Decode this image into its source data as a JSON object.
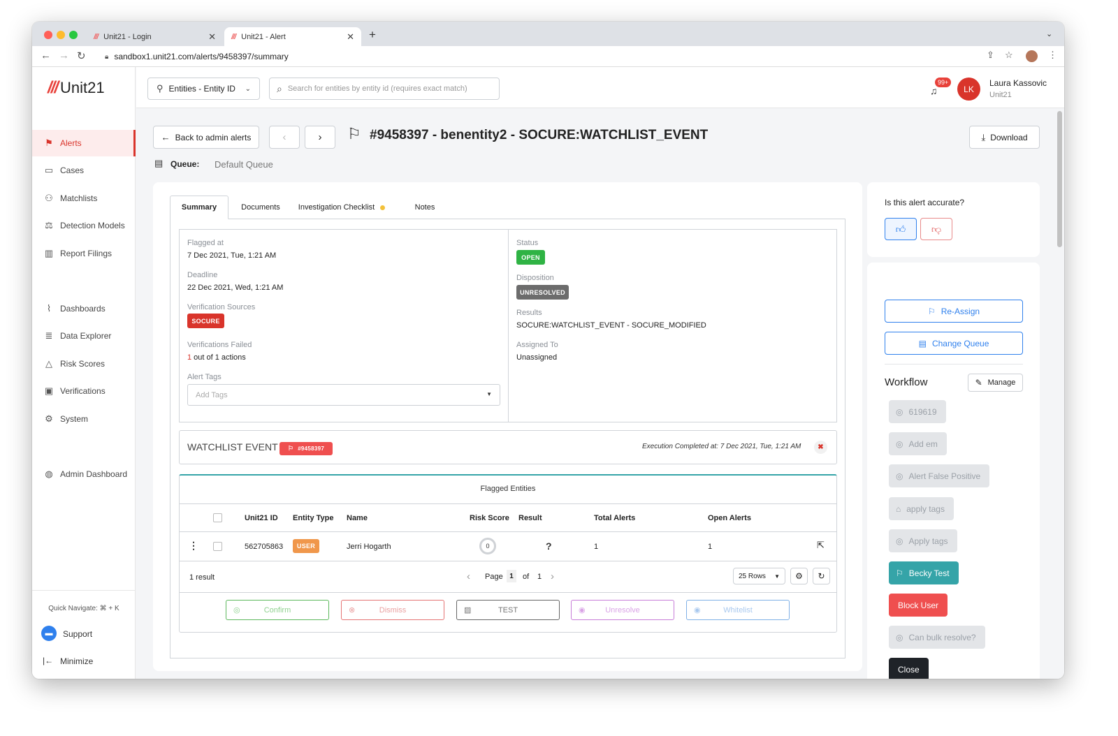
{
  "browser": {
    "tabs": [
      {
        "label": "Unit21 - Login",
        "active": false
      },
      {
        "label": "Unit21 - Alert",
        "active": true
      }
    ],
    "new_tab": "+",
    "url": "sandbox1.unit21.com/alerts/9458397/summary"
  },
  "sidebar": {
    "logo": "Unit21",
    "items": [
      {
        "label": "Alerts",
        "icon": "flag-icon",
        "active": true
      },
      {
        "label": "Cases",
        "icon": "briefcase-icon"
      },
      {
        "label": "Matchlists",
        "icon": "user-list-icon"
      },
      {
        "label": "Detection Models",
        "icon": "scale-icon"
      },
      {
        "label": "Report Filings",
        "icon": "building-icon"
      },
      {
        "label": "Dashboards",
        "icon": "chart-icon"
      },
      {
        "label": "Data Explorer",
        "icon": "explorer-icon"
      },
      {
        "label": "Risk Scores",
        "icon": "warning-icon"
      },
      {
        "label": "Verifications",
        "icon": "id-card-icon"
      },
      {
        "label": "System",
        "icon": "gear-icon"
      },
      {
        "label": "Admin Dashboard",
        "icon": "globe-icon"
      }
    ],
    "quick_navigate": "Quick Navigate: ⌘ + K",
    "support": "Support",
    "minimize": "Minimize"
  },
  "topbar": {
    "entity_select": "Entities - Entity ID",
    "search_placeholder": "Search for entities by entity id (requires exact match)",
    "notif_count": "99+",
    "user_initials": "LK",
    "user_name": "Laura Kassovic",
    "user_org": "Unit21"
  },
  "header": {
    "back_label": "Back to admin alerts",
    "title": "#9458397 - benentity2 - SOCURE:WATCHLIST_EVENT",
    "download_label": "Download",
    "queue_label": "Queue:",
    "queue_value": "Default Queue"
  },
  "tabs": [
    "Summary",
    "Documents",
    "Investigation Checklist",
    "Notes"
  ],
  "summary": {
    "flagged_at_label": "Flagged at",
    "flagged_at": "7 Dec 2021, Tue, 1:21 AM",
    "deadline_label": "Deadline",
    "deadline": "22 Dec 2021, Wed, 1:21 AM",
    "verification_sources_label": "Verification Sources",
    "verification_source": "SOCURE",
    "verifications_failed_label": "Verifications Failed",
    "failed_count": "1",
    "failed_rest": " out of 1 actions",
    "alert_tags_label": "Alert Tags",
    "tags_placeholder": "Add Tags",
    "status_label": "Status",
    "status": "OPEN",
    "disposition_label": "Disposition",
    "disposition": "UNRESOLVED",
    "results_label": "Results",
    "results": "SOCURE:WATCHLIST_EVENT - SOCURE_MODIFIED",
    "assigned_label": "Assigned To",
    "assigned": "Unassigned"
  },
  "event": {
    "title": "WATCHLIST EVENT",
    "badge": "#9458397",
    "execution": "Execution Completed at: 7 Dec 2021, Tue, 1:21 AM"
  },
  "table": {
    "title": "Flagged Entities",
    "columns": [
      "Unit21 ID",
      "Entity Type",
      "Name",
      "Risk Score",
      "Result",
      "Total Alerts",
      "Open Alerts"
    ],
    "rows": [
      {
        "id": "562705863",
        "type": "USER",
        "name": "Jerri Hogarth",
        "risk": "0",
        "result": "?",
        "total": "1",
        "open": "1"
      }
    ],
    "result_count": "1 result",
    "page_label": "Page",
    "page": "1",
    "of_label": "of",
    "pages": "1",
    "rows_select": "25 Rows"
  },
  "actions": [
    {
      "label": "Confirm",
      "color": "#5cb85c"
    },
    {
      "label": "Dismiss",
      "color": "#e57373"
    },
    {
      "label": "TEST",
      "color": "#666666"
    },
    {
      "label": "Unresolve",
      "color": "#c77dd8"
    },
    {
      "label": "Whitelist",
      "color": "#7fb0e6"
    }
  ],
  "right_panel": {
    "accuracy_question": "Is this alert accurate?",
    "reassign": "Re-Assign",
    "change_queue": "Change Queue",
    "workflow_title": "Workflow",
    "manage": "Manage",
    "workflow_buttons": [
      {
        "label": "619619",
        "icon": "check-circle-icon"
      },
      {
        "label": "Add em",
        "icon": "check-circle-icon"
      },
      {
        "label": "Alert False Positive",
        "icon": "check-circle-icon"
      },
      {
        "label": "apply tags",
        "icon": "tag-icon"
      },
      {
        "label": "Apply tags",
        "icon": "check-circle-icon"
      }
    ],
    "becky_test": "Becky Test",
    "block_user": "Block User",
    "bulk_resolve": "Can bulk resolve?",
    "close": "Close"
  },
  "colors": {
    "brand_red": "#d9342b",
    "open_green": "#2fb344",
    "teal": "#35a4a8",
    "block_red": "#ef4f4f",
    "link_blue": "#2f80ed"
  }
}
